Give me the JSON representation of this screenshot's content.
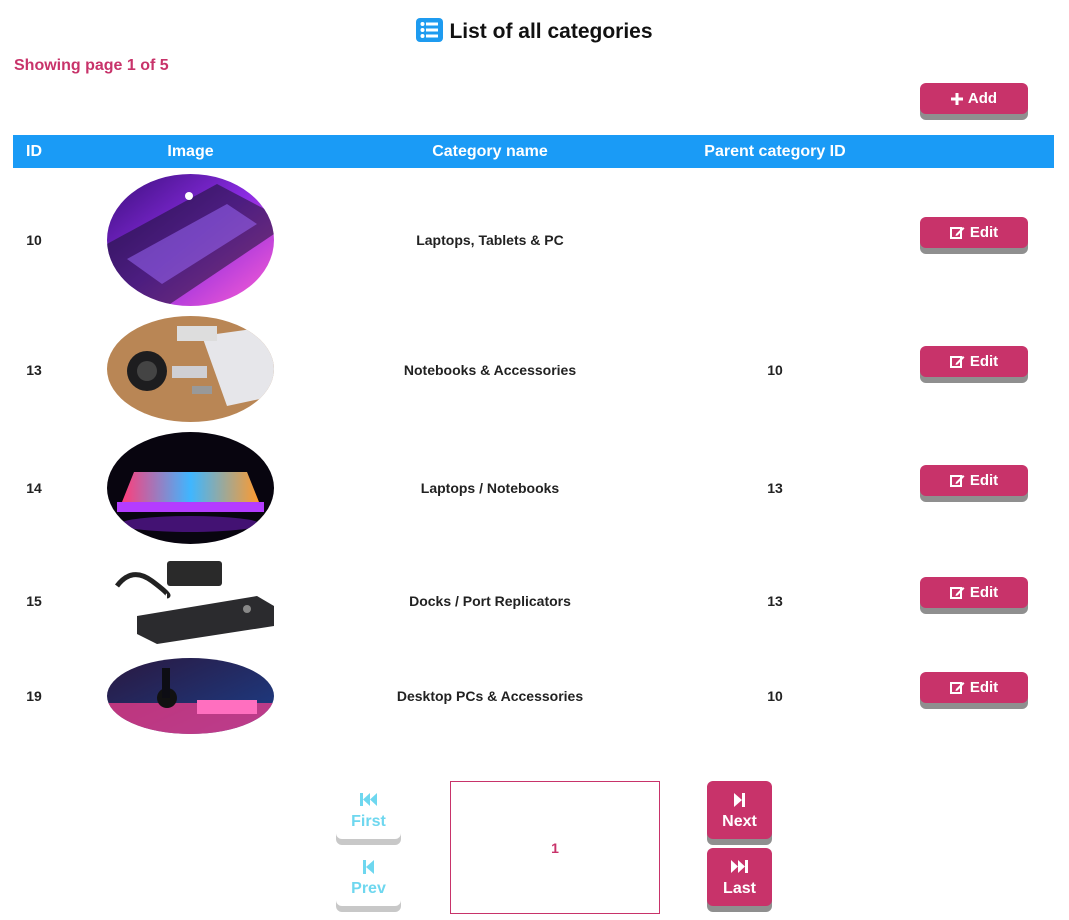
{
  "header": {
    "title": "List of all categories",
    "page_status": "Showing page 1 of 5"
  },
  "toolbar": {
    "add_label": "Add"
  },
  "table": {
    "columns": [
      "ID",
      "Image",
      "Category name",
      "Parent category ID",
      ""
    ],
    "rows": [
      {
        "id": "10",
        "name": "Laptops, Tablets & PC",
        "parent_id": "",
        "edit_label": "Edit"
      },
      {
        "id": "13",
        "name": "Notebooks & Accessories",
        "parent_id": "10",
        "edit_label": "Edit"
      },
      {
        "id": "14",
        "name": "Laptops / Notebooks",
        "parent_id": "13",
        "edit_label": "Edit"
      },
      {
        "id": "15",
        "name": "Docks / Port Replicators",
        "parent_id": "13",
        "edit_label": "Edit"
      },
      {
        "id": "19",
        "name": "Desktop PCs & Accessories",
        "parent_id": "10",
        "edit_label": "Edit"
      }
    ]
  },
  "pagination": {
    "first_label": "First",
    "prev_label": "Prev",
    "next_label": "Next",
    "last_label": "Last",
    "current_page": "1"
  },
  "colors": {
    "accent": "#c8336a",
    "header_blue": "#1a9bf6",
    "disabled_cyan": "#6ed7ef"
  },
  "icons": {
    "title": "list-icon",
    "add": "plus-icon",
    "edit": "edit-icon",
    "first": "skip-back-icon",
    "prev": "step-back-icon",
    "next": "step-forward-icon",
    "last": "skip-forward-icon"
  }
}
